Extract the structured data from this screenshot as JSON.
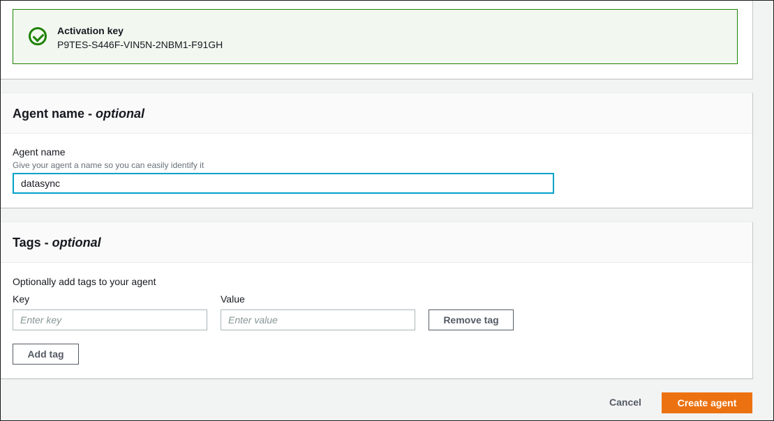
{
  "activation": {
    "title": "Activation key",
    "key": "P9TES-S446F-VIN5N-2NBM1-F91GH",
    "icon": "check-circle-icon",
    "color": "#1d8102"
  },
  "agent_section": {
    "title": "Agent name - ",
    "optional": "optional",
    "field_label": "Agent name",
    "field_description": "Give your agent a name so you can easily identify it",
    "field_value": "datasync"
  },
  "tags_section": {
    "title": "Tags - ",
    "optional": "optional",
    "intro": "Optionally add tags to your agent",
    "key_label": "Key",
    "value_label": "Value",
    "key_placeholder": "Enter key",
    "value_placeholder": "Enter value",
    "remove_label": "Remove tag",
    "add_label": "Add tag"
  },
  "footer": {
    "cancel_label": "Cancel",
    "create_label": "Create agent",
    "primary_color": "#ec7211"
  }
}
